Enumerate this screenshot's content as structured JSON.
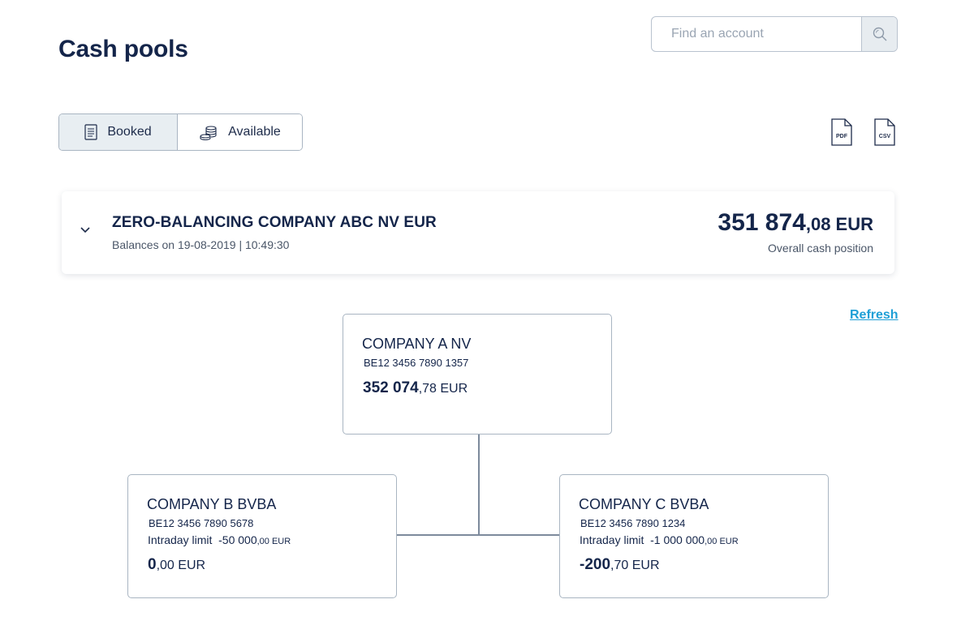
{
  "header": {
    "title": "Cash pools"
  },
  "search": {
    "placeholder": "Find an account",
    "value": ""
  },
  "toggle": {
    "booked_label": "Booked",
    "available_label": "Available",
    "selected": "Booked"
  },
  "exports": {
    "pdf_label": "PDF",
    "csv_label": "CSV"
  },
  "pool": {
    "name": "ZERO-BALANCING COMPANY ABC NV EUR",
    "balances_on": "Balances on 19-08-2019 | 10:49:30",
    "amount_int": "351 874",
    "amount_dec": ",08",
    "amount_cur": " EUR",
    "amount_label": "Overall cash position"
  },
  "refresh_label": "Refresh",
  "accounts": {
    "master": {
      "name": "COMPANY A NV",
      "iban": "BE12 3456 7890 1357",
      "balance_int": "352 074",
      "balance_dec": ",78",
      "balance_cur": " EUR"
    },
    "child_b": {
      "name": "COMPANY B BVBA",
      "iban": "BE12 3456 7890 5678",
      "limit_label": "Intraday limit",
      "limit_int": "-50 000",
      "limit_dec": ",00 EUR",
      "balance_int": "0",
      "balance_dec": ",00",
      "balance_cur": " EUR"
    },
    "child_c": {
      "name": "COMPANY C BVBA",
      "iban": "BE12 3456 7890 1234",
      "limit_label": "Intraday limit",
      "limit_int": "-1 000 000",
      "limit_dec": ",00 EUR",
      "balance_int": "-200",
      "balance_dec": ",70",
      "balance_cur": " EUR"
    }
  },
  "colors": {
    "primary_text": "#14254a",
    "link": "#1e9fd6",
    "border": "#a9b5c2",
    "selected_bg": "#e8eef2"
  }
}
